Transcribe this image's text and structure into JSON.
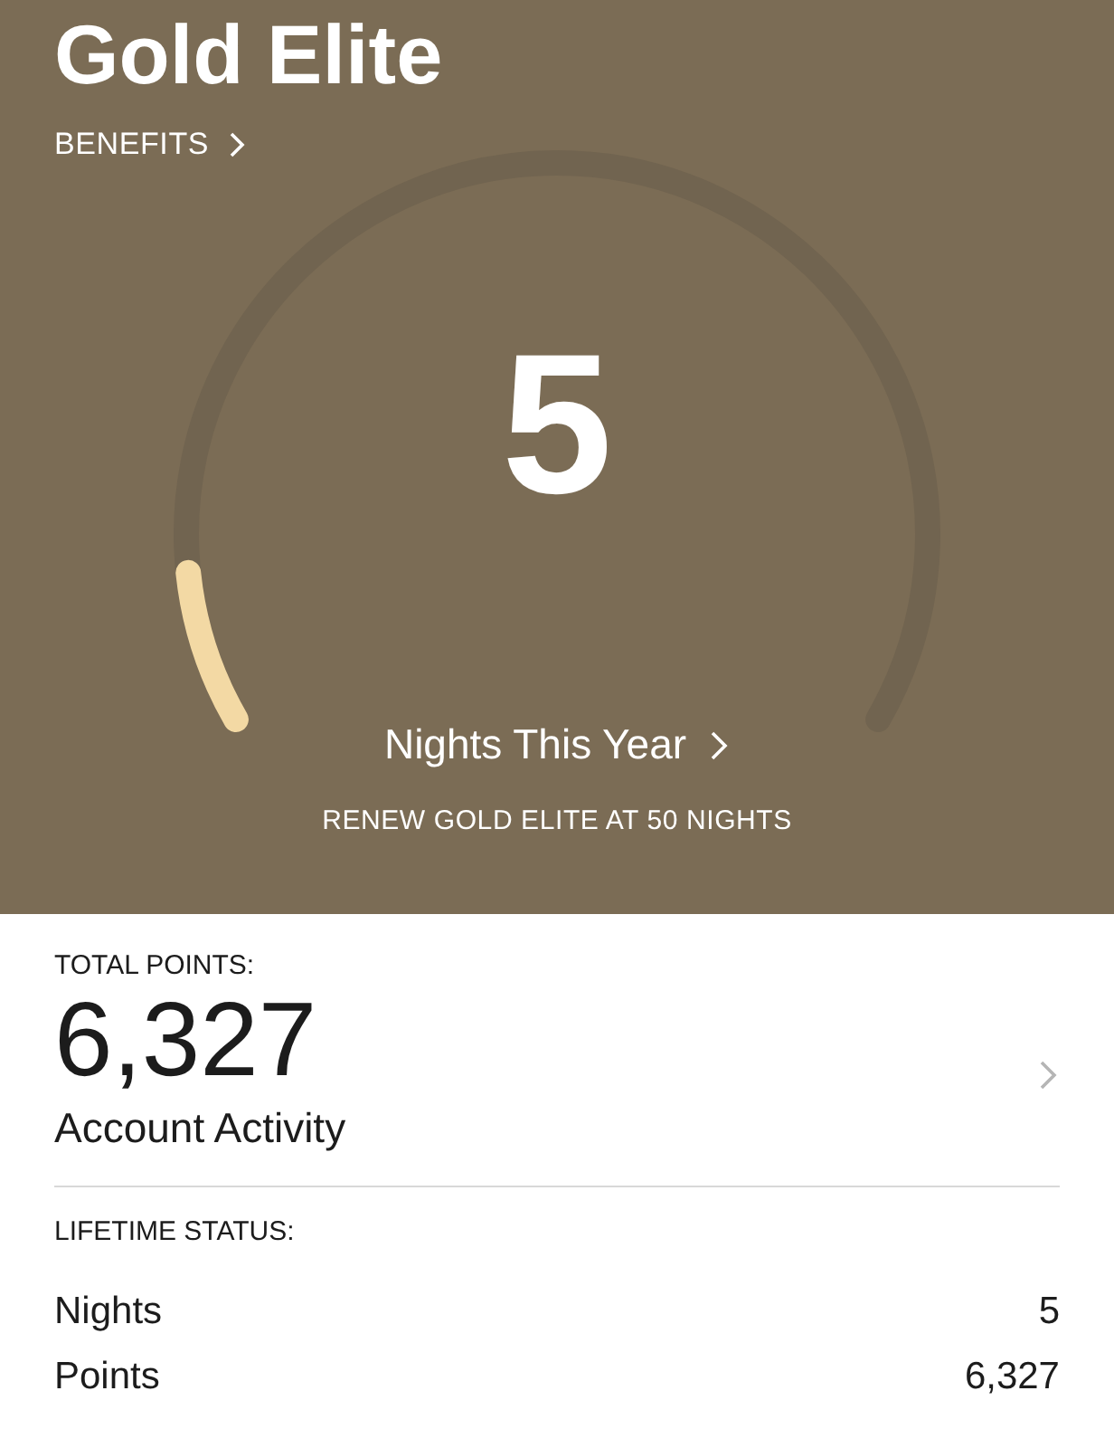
{
  "header": {
    "title": "Gold Elite",
    "benefits_link": "BENEFITS"
  },
  "nights_gauge": {
    "value": "5",
    "level": 0.1,
    "label": "Nights This Year",
    "renew_note": "RENEW GOLD ELITE AT 50 NIGHTS"
  },
  "total_points": {
    "label": "TOTAL POINTS:",
    "value": "6,327",
    "link": "Account Activity"
  },
  "lifetime_status": {
    "label": "LIFETIME STATUS:",
    "rows": [
      {
        "label": "Nights",
        "value": "5"
      },
      {
        "label": "Points",
        "value": "6,327"
      }
    ]
  }
}
